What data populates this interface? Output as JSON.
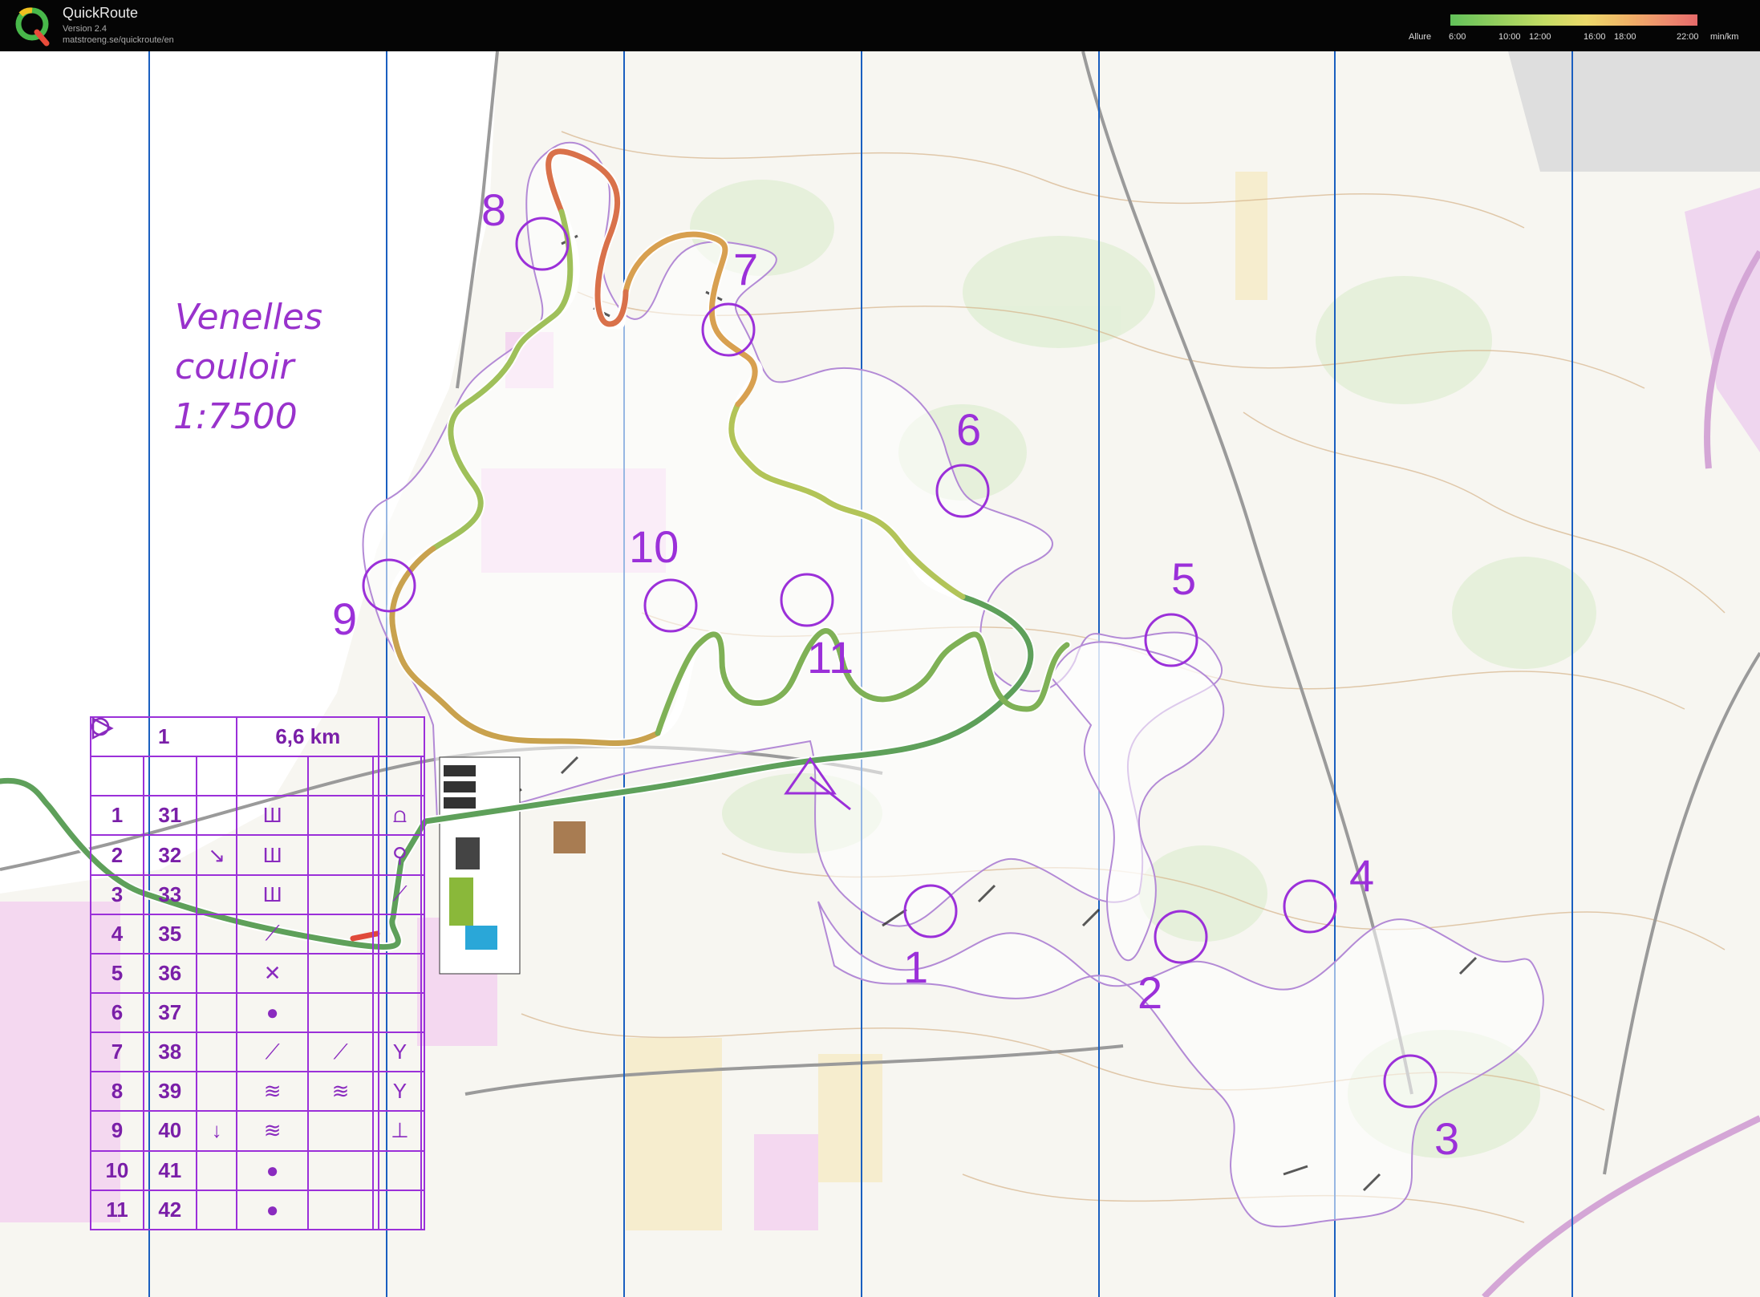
{
  "app": {
    "title": "QuickRoute",
    "version": "Version 2.4",
    "url": "matstroeng.se/quickroute/en",
    "logo_icon": "quickroute-logo-icon"
  },
  "legend": {
    "title": "Allure",
    "ticks": [
      "6:00",
      "10:00",
      "12:00",
      "16:00",
      "18:00",
      "22:00"
    ],
    "unit": "min/km",
    "colors": [
      "#62c25a",
      "#c4dc64",
      "#ecd96a",
      "#f0b267",
      "#e66a6a"
    ]
  },
  "map": {
    "title_lines": [
      "Venelles",
      "couloir",
      "1:7500"
    ],
    "course_color": "#9b30d9",
    "controls": [
      {
        "label": "1"
      },
      {
        "label": "2"
      },
      {
        "label": "3"
      },
      {
        "label": "4"
      },
      {
        "label": "5"
      },
      {
        "label": "6"
      },
      {
        "label": "7"
      },
      {
        "label": "8"
      },
      {
        "label": "9"
      },
      {
        "label": "10"
      },
      {
        "label": "11"
      }
    ]
  },
  "description": {
    "course": "1",
    "length": "6,6 km",
    "start_symbol": "triangle",
    "rows": [
      {
        "num": "1",
        "code": "31",
        "sym1": "",
        "sym2": "Ш",
        "sym3": "",
        "sym4": "⩍"
      },
      {
        "num": "2",
        "code": "32",
        "sym1": "↘",
        "sym2": "Ш",
        "sym3": "",
        "sym4": "⚲"
      },
      {
        "num": "3",
        "code": "33",
        "sym1": "",
        "sym2": "Ш",
        "sym3": "",
        "sym4": "⟋"
      },
      {
        "num": "4",
        "code": "35",
        "sym1": "",
        "sym2": "⟋",
        "sym3": "",
        "sym4": ""
      },
      {
        "num": "5",
        "code": "36",
        "sym1": "",
        "sym2": "✕",
        "sym3": "",
        "sym4": ""
      },
      {
        "num": "6",
        "code": "37",
        "sym1": "",
        "sym2": "●",
        "sym3": "",
        "sym4": ""
      },
      {
        "num": "7",
        "code": "38",
        "sym1": "",
        "sym2": "⟋",
        "sym3": "⟋",
        "sym4": "Y"
      },
      {
        "num": "8",
        "code": "39",
        "sym1": "",
        "sym2": "≋",
        "sym3": "≋",
        "sym4": "Y"
      },
      {
        "num": "9",
        "code": "40",
        "sym1": "↓",
        "sym2": "≋",
        "sym3": "",
        "sym4": "⊥"
      },
      {
        "num": "10",
        "code": "41",
        "sym1": "",
        "sym2": "●",
        "sym3": "",
        "sym4": ""
      },
      {
        "num": "11",
        "code": "42",
        "sym1": "",
        "sym2": "●",
        "sym3": "",
        "sym4": ""
      }
    ]
  }
}
